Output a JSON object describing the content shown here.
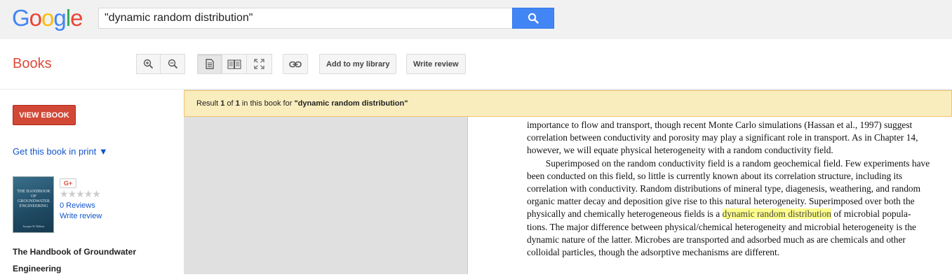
{
  "header": {
    "logo_letters": [
      {
        "ch": "G",
        "color": "#4285f4"
      },
      {
        "ch": "o",
        "color": "#ea4335"
      },
      {
        "ch": "o",
        "color": "#fbbc05"
      },
      {
        "ch": "g",
        "color": "#4285f4"
      },
      {
        "ch": "l",
        "color": "#34a853"
      },
      {
        "ch": "e",
        "color": "#ea4335"
      }
    ],
    "search_value": "\"dynamic random distribution\"",
    "search_icon": "search-icon"
  },
  "toolbar": {
    "section_title": "Books",
    "zoom_in_icon": "zoom-in-icon",
    "zoom_out_icon": "zoom-out-icon",
    "single_page_icon": "single-page-icon",
    "two_page_icon": "two-page-icon",
    "fullscreen_icon": "fullscreen-icon",
    "link_icon": "link-icon",
    "add_library_label": "Add to my library",
    "write_review_label": "Write review"
  },
  "sidebar": {
    "view_ebook_label": "VIEW EBOOK",
    "get_print_label": "Get this book in print ▼",
    "cover_title": "THE HANDBOOK OF GROUNDWATER ENGINEERING",
    "cover_author": "Jacques W. Delleur",
    "gplus_label": "G+",
    "stars": "★★★★★",
    "reviews_label": "0 Reviews",
    "write_review_label": "Write review",
    "book_title": "The Handbook of Groundwater Engineering"
  },
  "viewer": {
    "result_prefix": "Result ",
    "result_index": "1",
    "result_of": " of ",
    "result_total": "1",
    "result_mid": " in this book for ",
    "result_query": "\"dynamic random distribution\"",
    "lines": [
      "importance to flow and transport, though recent Monte Carlo simulations (Hassan et al., 1997) suggest",
      "correlation between conductivity and porosity may play a significant role in transport. As in Chapter 14,",
      "however, we will equate physical heterogeneity with a random conductivity field.",
      "  Superimposed on the random conductivity field is a random geochemical field. Few experiments have",
      "been conducted on this field, so little is currently known about its correlation structure, including its",
      "correlation with conductivity. Random distributions of mineral type, diagenesis, weathering, and random",
      "organic matter decay and deposition give rise to this natural heterogeneity. Superimposed over both the"
    ],
    "line8_before": "physically and chemically heterogeneous fields is a ",
    "line8_highlight": "dynamic random distribution",
    "line8_after": " of microbial popula-",
    "lines_after": [
      "tions. The major difference between physical/chemical heterogeneity and microbial heterogeneity is the",
      "dynamic nature of the latter. Microbes are transported and adsorbed much as are chemicals and other",
      "colloidal particles, though the adsorptive mechanisms are different."
    ]
  },
  "colors": {
    "accent_red": "#dd4b39",
    "search_blue": "#4285f4",
    "link_blue": "#1155cc",
    "result_bar": "#f9edbe",
    "highlight": "#ffff8c"
  }
}
